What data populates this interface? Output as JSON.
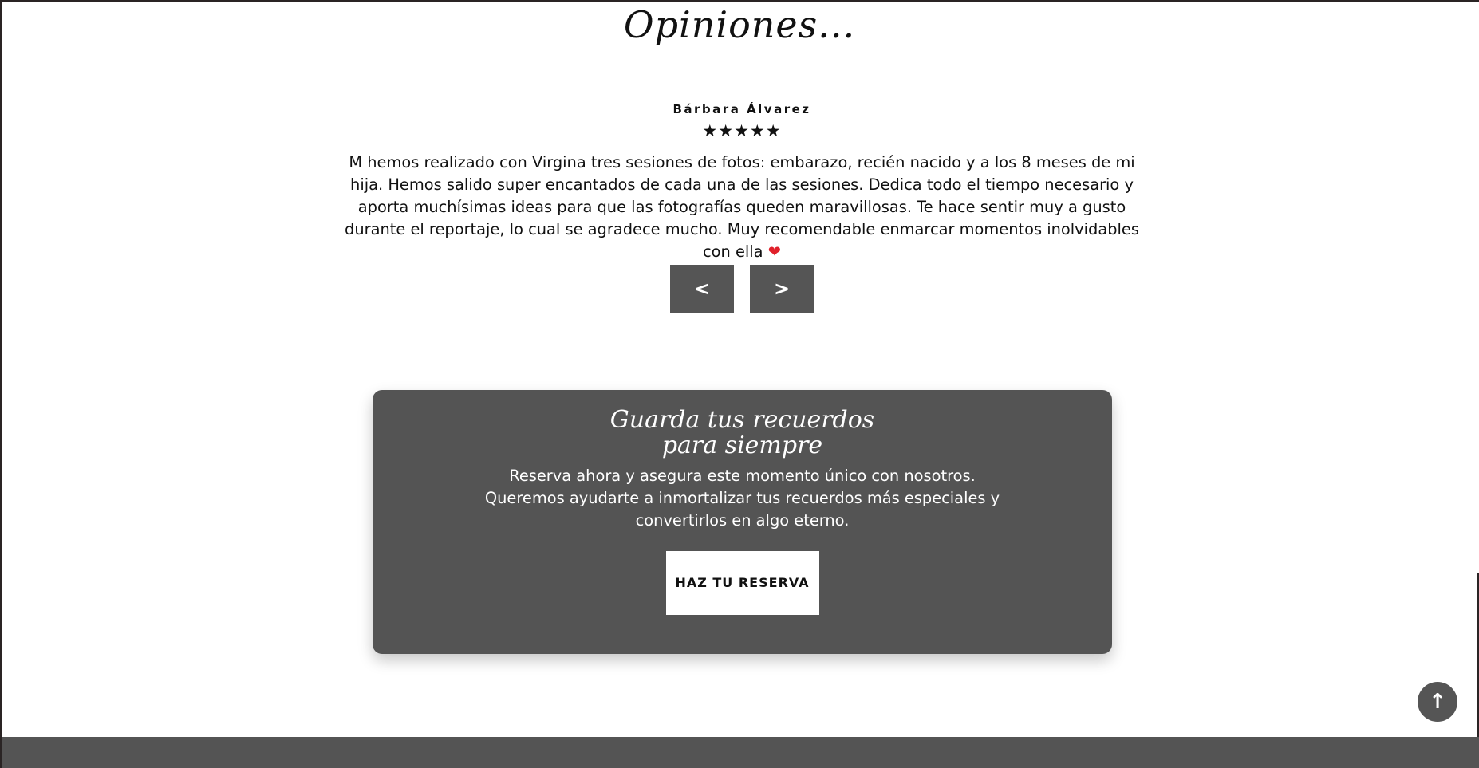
{
  "section": {
    "title": "Opiniones..."
  },
  "testimonial": {
    "author": "Bárbara Álvarez",
    "rating_text": "★★★★★",
    "rating": 5,
    "review": "M hemos realizado con Virgina tres sesiones de fotos: embarazo, recién nacido y a los 8 meses de mi hija. Hemos salido super encantados de cada una de las sesiones. Dedica todo el tiempo necesario y aporta muchísimas ideas para que las fotografías queden maravillosas. Te hace sentir muy a gusto durante el reportaje, lo cual se agradece mucho. Muy recomendable enmarcar momentos inolvidables con ella",
    "heart_icon": "❤"
  },
  "carousel": {
    "prev_label": "<",
    "next_label": ">"
  },
  "cta": {
    "title_line1": "Guarda tus recuerdos",
    "title_line2": "para siempre",
    "text_line1": "Reserva ahora y asegura este momento único con nosotros.",
    "text_line2": "Queremos ayudarte a inmortalizar tus recuerdos más especiales y",
    "text_line3": "convertirlos en algo eterno.",
    "button_label": "HAZ TU RESERVA"
  },
  "scroll_top": {
    "icon": "↑",
    "icon_name": "arrow-up-icon"
  },
  "colors": {
    "dark_gray": "#555555",
    "card_gray": "#545454",
    "heart_red": "#e0202a",
    "frame": "#2a2424"
  }
}
